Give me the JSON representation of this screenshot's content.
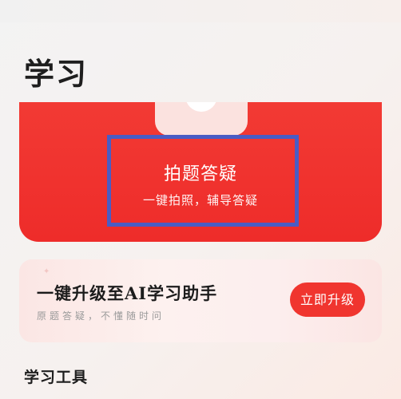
{
  "page": {
    "title": "学习"
  },
  "hero": {
    "title": "拍题答疑",
    "subtitle": "一键拍照，辅导答疑",
    "tab_icon": "camera-icon",
    "accent_color": "#ef2f2b"
  },
  "upgrade": {
    "title": "一键升级至AI学习助手",
    "description": "原题答疑，不懂随时问",
    "button_label": "立即升级",
    "accent_color": "#f0352f"
  },
  "section": {
    "title": "学习工具"
  }
}
